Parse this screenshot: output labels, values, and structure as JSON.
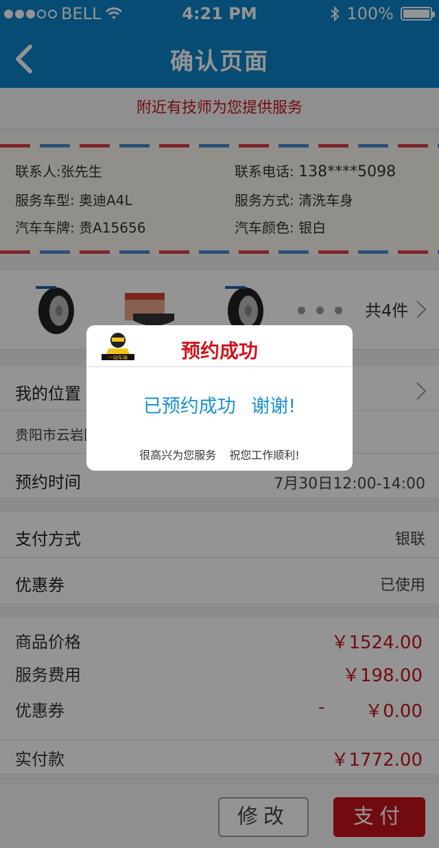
{
  "status_bar": {
    "carrier": "BELL",
    "time": "4:21 PM",
    "battery": "100%"
  },
  "nav": {
    "title": "确认页面"
  },
  "notice": "附近有技师为您提供服务",
  "contact": {
    "name": "联系人:张先生",
    "phone_label": "联系电话:",
    "phone": "138****5098",
    "model_label": "服务车型:",
    "model": "奥迪A4L",
    "service_label": "服务方式:",
    "service": "清洗车身",
    "plate_label": "汽车车牌:",
    "plate": "贵A15656",
    "color_label": "汽车颜色:",
    "color": "银白"
  },
  "products": {
    "count": "共4件"
  },
  "location": {
    "label": "我的位置",
    "address": "贵阳市云岩区"
  },
  "appointment": {
    "label": "预约时间",
    "value": "7月30日12:00-14:00"
  },
  "payment": {
    "label": "支付方式",
    "value": "银联"
  },
  "coupon": {
    "label": "优惠券",
    "value": "已使用"
  },
  "prices": {
    "goods_label": "商品价格",
    "goods": "￥1524.00",
    "fee_label": "服务费用",
    "fee": "￥198.00",
    "coupon_label": "优惠券",
    "coupon_minus": "-",
    "coupon": "￥0.00",
    "total_label": "实付款",
    "total": "￥1772.00"
  },
  "buttons": {
    "modify": "修改",
    "pay": "支付"
  },
  "dialog": {
    "title": "预约成功",
    "message": "已预约成功 谢谢!",
    "sub": "很高兴为您服务 祝您工作顺利!",
    "logo_text": "一动车保"
  },
  "colors": {
    "nav_blue": "#0b84c9",
    "accent_red": "#c4141c",
    "dialog_blue": "#1a8fd1"
  }
}
